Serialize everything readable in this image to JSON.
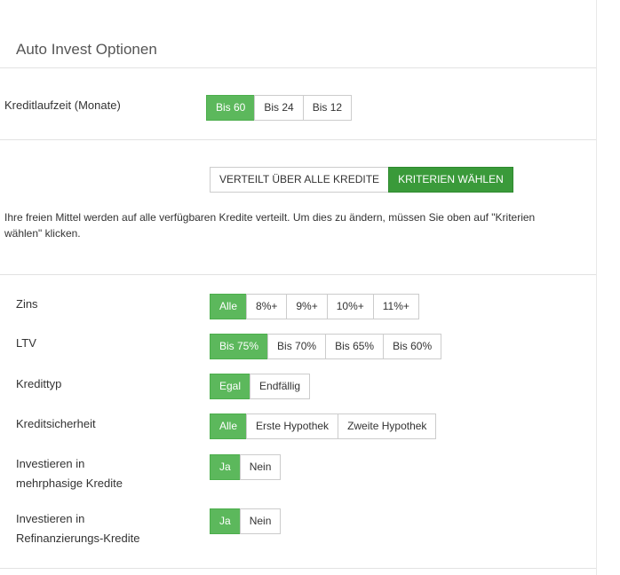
{
  "section": {
    "title": "Auto Invest Optionen"
  },
  "laufzeit": {
    "label": "Kreditlaufzeit (Monate)",
    "options": [
      "Bis 60",
      "Bis 24",
      "Bis 12"
    ],
    "selected": "Bis 60"
  },
  "mode": {
    "options": [
      "VERTEILT ÜBER ALLE KREDITE",
      "KRITERIEN WÄHLEN"
    ],
    "selected": "KRITERIEN WÄHLEN",
    "note": "Ihre freien Mittel werden auf alle verfügbaren Kredite verteilt. Um dies zu ändern, müssen Sie oben auf \"Kriterien wählen\" klicken."
  },
  "zins": {
    "label": "Zins",
    "options": [
      "Alle",
      "8%+",
      "9%+",
      "10%+",
      "11%+"
    ],
    "selected": "Alle"
  },
  "ltv": {
    "label": "LTV",
    "options": [
      "Bis 75%",
      "Bis 70%",
      "Bis 65%",
      "Bis 60%"
    ],
    "selected": "Bis 75%"
  },
  "kredittyp": {
    "label": "Kredittyp",
    "options": [
      "Egal",
      "Endfällig"
    ],
    "selected": "Egal"
  },
  "sicherheit": {
    "label": "Kreditsicherheit",
    "options": [
      "Alle",
      "Erste Hypothek",
      "Zweite Hypothek"
    ],
    "selected": "Alle"
  },
  "mehrphasig": {
    "label_line1": "Investieren in",
    "label_line2": "mehrphasige Kredite",
    "options": [
      "Ja",
      "Nein"
    ],
    "selected": "Ja"
  },
  "refinanz": {
    "label_line1": "Investieren in",
    "label_line2": "Refinanzierungs-Kredite",
    "options": [
      "Ja",
      "Nein"
    ],
    "selected": "Ja"
  },
  "colors": {
    "accent": "#5cb85c",
    "accent_dark": "#3a9a3a",
    "border": "#cccccc"
  }
}
